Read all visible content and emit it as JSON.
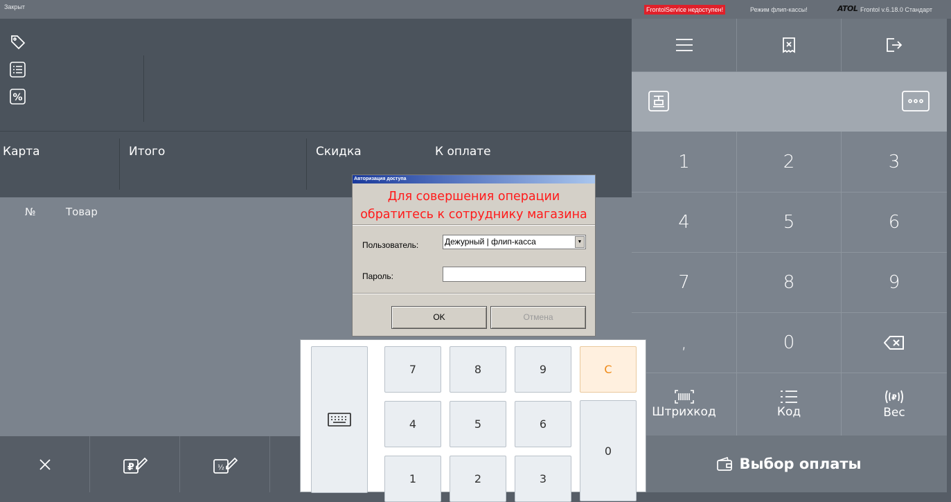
{
  "titlebar": {
    "state": "Закрыт",
    "service_warning": "FrontolService недоступен!",
    "mode": "Режим флип-кассы!",
    "logo": "ATOL",
    "version": "Frontol v.6.18.0 Стандарт",
    "warning_color": "#e0202a"
  },
  "left_icons": [
    "tag-icon",
    "list-icon",
    "percent-icon"
  ],
  "totals": {
    "card_label": "Карта",
    "total_label": "Итого",
    "discount_label": "Скидка",
    "to_pay_label": "К оплате"
  },
  "items": {
    "col_no": "№",
    "col_product": "Товар"
  },
  "bottom_actions": [
    "close-icon",
    "price-edit-icon",
    "quantity-edit-icon"
  ],
  "right_panel": {
    "top_icons": [
      "menu-icon",
      "receipt-cancel-icon",
      "logout-icon"
    ],
    "row2_icons": [
      "cash-register-icon",
      "more-icon"
    ],
    "digits": [
      "1",
      "2",
      "3",
      "4",
      "5",
      "6",
      "7",
      "8",
      "9",
      ",",
      "0"
    ],
    "barcode_label": "Штрихкод",
    "code_label": "Код",
    "weight_label": "Вес",
    "payment_label": "Выбор оплаты"
  },
  "dialog": {
    "caption": "Авторизация доступа",
    "message_line1": "Для совершения операции",
    "message_line2": "обратитесь к сотруднику магазина",
    "user_label": "Пользователь:",
    "user_value": "Дежурный  | флип-касса",
    "password_label": "Пароль:",
    "ok_label": "OK",
    "cancel_label": "Отмена",
    "message_color": "#ff1a1a"
  },
  "numpad": {
    "keys": [
      "7",
      "8",
      "9",
      "4",
      "5",
      "6",
      "1",
      "2",
      "3"
    ],
    "clear": "C",
    "zero": "0"
  }
}
